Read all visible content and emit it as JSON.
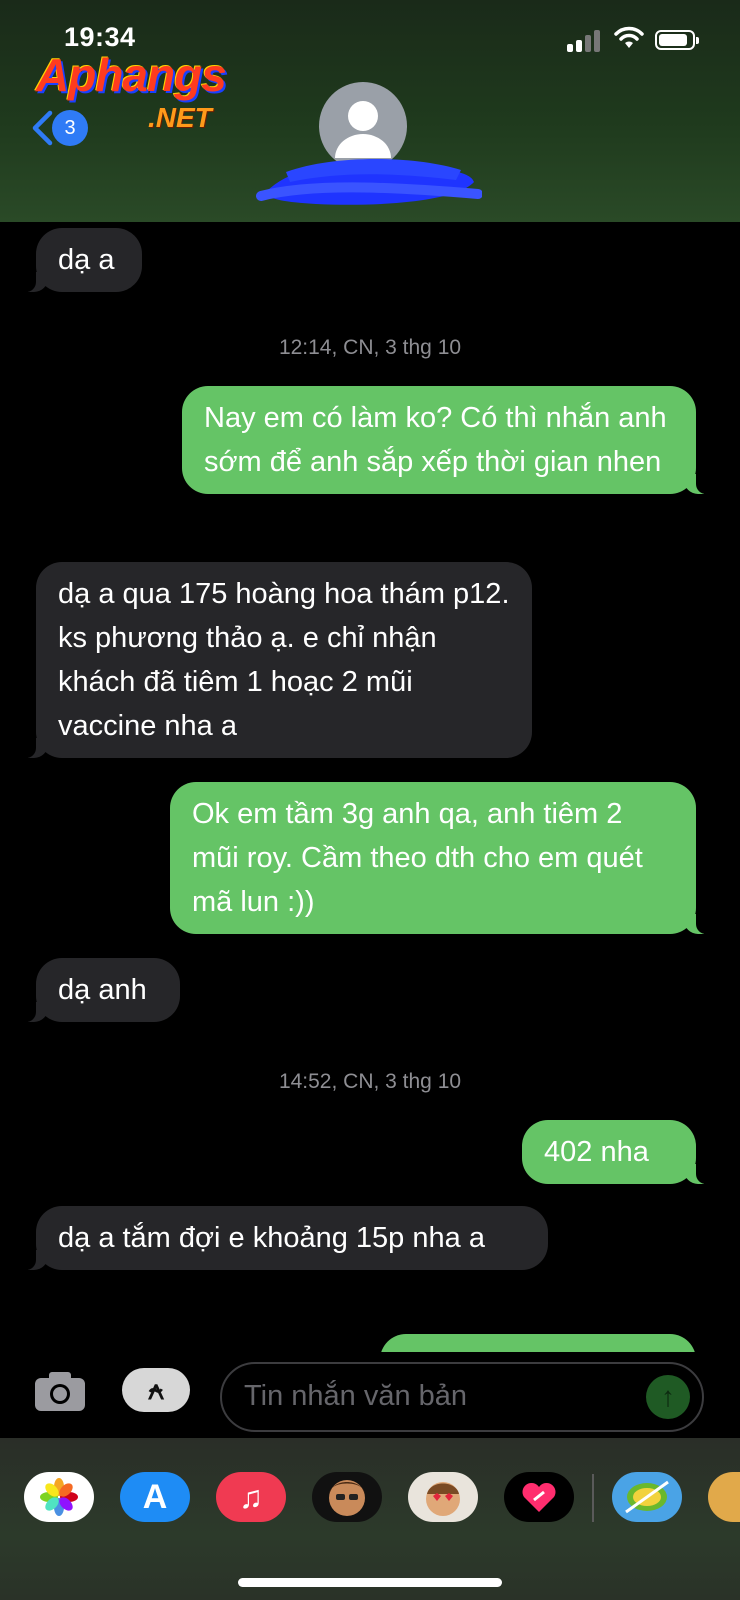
{
  "status_bar": {
    "time": "19:34"
  },
  "watermark": {
    "line1": "Aphangs",
    "line2": ".NET"
  },
  "nav": {
    "back_count": "3"
  },
  "thread": [
    {
      "type": "in",
      "text": "dạ a"
    },
    {
      "type": "stamp",
      "text": "12:14, CN, 3 thg 10"
    },
    {
      "type": "out",
      "text": "Nay em có làm ko? Có thì nhắn anh sớm để anh sắp xếp thời gian nhen"
    },
    {
      "type": "in",
      "text": "dạ a qua 175 hoàng hoa thám p12. ks phương thảo ạ. e chỉ nhận khách đã tiêm 1 hoạc 2 mũi vaccine nha a"
    },
    {
      "type": "out",
      "text": "Ok em tầm 3g anh qa, anh tiêm 2 mũi roy. Cầm theo dth cho em quét mã lun :))"
    },
    {
      "type": "in",
      "text": "dạ anh"
    },
    {
      "type": "stamp",
      "text": "14:52, CN, 3 thg 10"
    },
    {
      "type": "out",
      "text": "402 nha"
    },
    {
      "type": "in",
      "text": "dạ a tắm đợi e khoảng 15p nha a"
    }
  ],
  "composer": {
    "placeholder": "Tin nhắn văn bản"
  },
  "app_tray": [
    {
      "icon": "photos-icon",
      "bg": "#ffffff"
    },
    {
      "icon": "app-store-icon",
      "bg": "#1e8cf5"
    },
    {
      "icon": "music-icon",
      "bg": "#f03a52"
    },
    {
      "icon": "memoji-icon",
      "bg": "#111111"
    },
    {
      "icon": "animoji-icon",
      "bg": "#e9e4dc"
    },
    {
      "icon": "digital-touch-icon",
      "bg": "#000000"
    },
    {
      "icon": "fruit-ninja-icon",
      "bg": "#4aa3e6"
    },
    {
      "icon": "game-icon",
      "bg": "#e1a94a"
    }
  ],
  "colors": {
    "incoming": "#262629",
    "outgoing": "#65c466",
    "accent": "#2f7bf6"
  }
}
